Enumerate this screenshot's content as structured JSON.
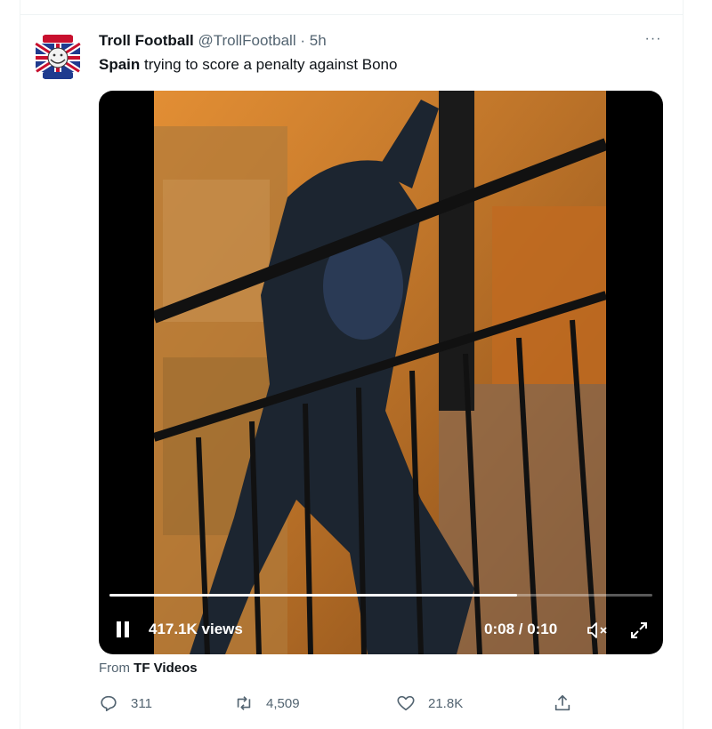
{
  "tweet": {
    "author_name": "Troll Football",
    "author_handle": "@TrollFootball",
    "separator": "·",
    "time": "5h",
    "text_bold": "Spain",
    "text_rest": " trying to score a penalty against Bono",
    "more_label": "···"
  },
  "video": {
    "views": "417.1K views",
    "timecode": "0:08 / 0:10",
    "progress": 0.75,
    "playing": true
  },
  "source": {
    "prefix": "From ",
    "name": "TF Videos"
  },
  "actions": {
    "reply_count": "311",
    "retweet_count": "4,509",
    "like_count": "21.8K"
  },
  "icons": {
    "reply": "reply-icon",
    "retweet": "retweet-icon",
    "like": "heart-icon",
    "share": "share-icon",
    "more": "more-icon",
    "mute": "volume-muted-icon",
    "expand": "expand-icon",
    "pause": "pause-icon"
  },
  "colors": {
    "secondary_text": "#536471",
    "primary_text": "#0f1419",
    "divider": "#eff3f4"
  }
}
